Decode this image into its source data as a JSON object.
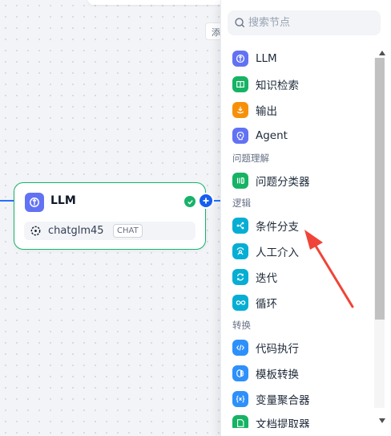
{
  "canvas": {
    "hint_fragment": "添"
  },
  "node": {
    "title": "LLM",
    "model_name": "chatglm45",
    "model_badge": "CHAT"
  },
  "search": {
    "placeholder": "搜索节点",
    "value": ""
  },
  "blocks": {
    "ungrouped": [
      {
        "label": "LLM",
        "icon": "llm-icon",
        "color": "#6172f3"
      },
      {
        "label": "知识检索",
        "icon": "book-icon",
        "color": "#16b364"
      },
      {
        "label": "输出",
        "icon": "output-icon",
        "color": "#f79009"
      },
      {
        "label": "Agent",
        "icon": "agent-icon",
        "color": "#6172f3"
      }
    ],
    "group_question": "问题理解",
    "question": [
      {
        "label": "问题分类器",
        "icon": "classifier-icon",
        "color": "#16b364"
      }
    ],
    "group_logic": "逻辑",
    "logic": [
      {
        "label": "条件分支",
        "icon": "branch-icon",
        "color": "#06aed4"
      },
      {
        "label": "人工介入",
        "icon": "human-icon",
        "color": "#06aed4"
      },
      {
        "label": "迭代",
        "icon": "iteration-icon",
        "color": "#06aed4"
      },
      {
        "label": "循环",
        "icon": "loop-icon",
        "color": "#06aed4"
      }
    ],
    "group_transform": "转换",
    "transform": [
      {
        "label": "代码执行",
        "icon": "code-icon",
        "color": "#2e90fa"
      },
      {
        "label": "模板转换",
        "icon": "template-icon",
        "color": "#2e90fa"
      },
      {
        "label": "变量聚合器",
        "icon": "variable-icon",
        "color": "#2e90fa"
      },
      {
        "label": "文档提取器",
        "icon": "doc-extract-icon",
        "color": "#16b364"
      }
    ]
  },
  "colors": {
    "accent": "#155eef",
    "success": "#17b26a",
    "annotation_arrow": "#f04438"
  }
}
